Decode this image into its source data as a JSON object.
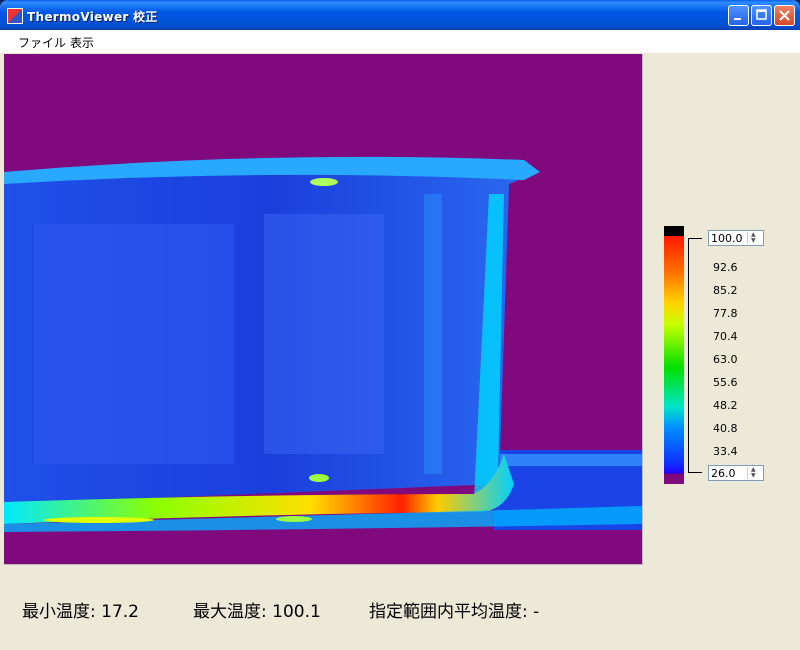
{
  "window": {
    "title": "ThermoViewer 校正"
  },
  "menu": {
    "items": [
      "ファイル",
      "表示"
    ]
  },
  "scale": {
    "max_value": "100.0",
    "min_value": "26.0",
    "ticks": [
      "92.6",
      "85.2",
      "77.8",
      "70.4",
      "63.0",
      "55.6",
      "48.2",
      "40.8",
      "33.4"
    ]
  },
  "status": {
    "min_label": "最小温度:",
    "min_value": "17.2",
    "max_label": "最大温度:",
    "max_value": "100.1",
    "avg_label": "指定範囲内平均温度:",
    "avg_value": "-"
  },
  "colors": {
    "background_purple": "#800a7d",
    "titlebar_blue": "#0058e6"
  }
}
